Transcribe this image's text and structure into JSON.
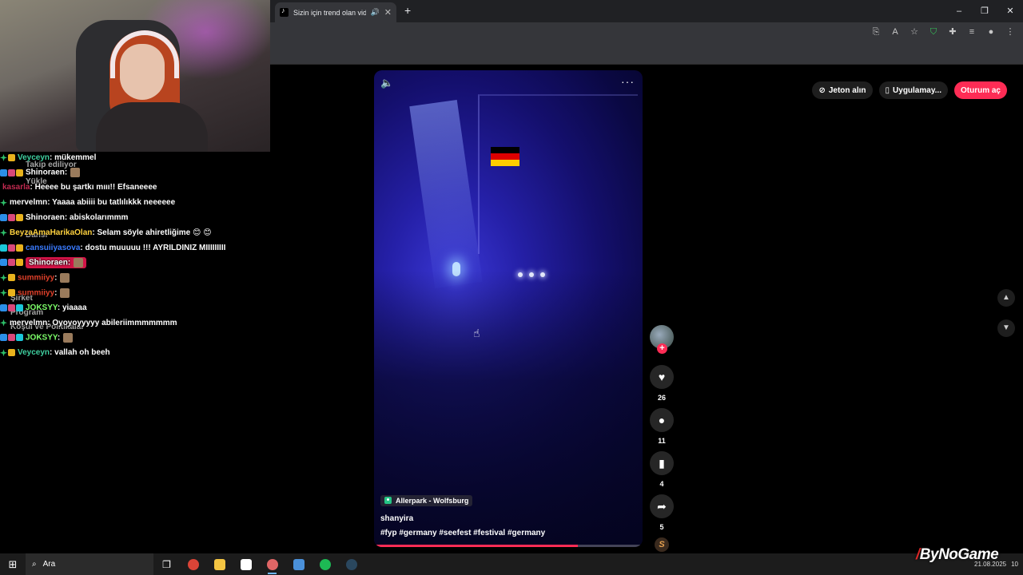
{
  "browser": {
    "tab_title": "Sizin için trend olan videolar",
    "tab_audio_icon": "speaker-icon",
    "tab_close": "✕",
    "new_tab": "+",
    "window_minimize": "–",
    "window_restore": "❐",
    "window_close": "✕"
  },
  "tiktok": {
    "coins_label": "Jeton alın",
    "app_label": "Uygulamay...",
    "login_label": "Oturum aç",
    "location": "Allerpark - Wolfsburg",
    "author": "shanyira",
    "hashtags": "#fyp #germany #seefest #festival #germany",
    "likes": "26",
    "comments": "11",
    "saves": "4",
    "shares": "5",
    "music_disc": "S",
    "progress": 0.76,
    "flag_colors": [
      "#000000",
      "#dd0000",
      "#ffce00"
    ],
    "accent": "#fe2c55"
  },
  "chat": {
    "messages": [
      {
        "user": "Veyceyn",
        "color": "#3fd0a0",
        "text": ": mükemmel",
        "badges": [
          "green",
          "gold"
        ]
      },
      {
        "user": "Shinoraen",
        "color": "#ffffff",
        "text": ":",
        "badges": [
          "blue",
          "pink",
          "gold"
        ],
        "emote": true
      },
      {
        "user": "kasarla",
        "color": "#c22a50",
        "text": ": Heeee bu şartkı mııı!! Efsaneeee",
        "badges": []
      },
      {
        "user": "mervelmn",
        "color": "#ffffff",
        "text": ": Yaaaa abiiii bu tatlılıkkk neeeeee",
        "badges": [
          "green"
        ]
      },
      {
        "user": "Shinoraen",
        "color": "#ffffff",
        "text": ": abiskolarımmm",
        "badges": [
          "blue",
          "pink",
          "gold"
        ]
      },
      {
        "user": "BeyzaAmaHarikaOlan",
        "color": "#ffd23f",
        "text": ": Selam söyle ahiretliğime 😊 😊",
        "badges": [
          "green"
        ]
      },
      {
        "user": "cansuiiyasova",
        "color": "#3a7bff",
        "text": ": dostu muuuuu !!! AYRILDINIZ MIIIIIIIII",
        "badges": [
          "cyan",
          "pink",
          "gold"
        ]
      },
      {
        "user": "Shinoraen",
        "color": "#ffffff",
        "text": ":",
        "badges": [
          "blue",
          "pink",
          "gold"
        ],
        "emote": true,
        "highlight": true
      },
      {
        "user": "summiiyy",
        "color": "#e0402a",
        "text": ":",
        "badges": [
          "green",
          "gold"
        ],
        "emote": true
      },
      {
        "user": "summiiyy",
        "color": "#e0402a",
        "text": ":",
        "badges": [
          "green",
          "gold"
        ],
        "emote": true
      },
      {
        "user": "JOKSYY",
        "color": "#7dff6a",
        "text": ": yiaaaa",
        "badges": [
          "blue",
          "pink",
          "cyan"
        ]
      },
      {
        "user": "mervelmn",
        "color": "#ffffff",
        "text": ": Oyoyoyyyyy abileriimmmmmmm",
        "badges": [
          "green"
        ]
      },
      {
        "user": "JOKSYY",
        "color": "#7dff6a",
        "text": ":",
        "badges": [
          "blue",
          "pink",
          "cyan"
        ],
        "emote": true
      },
      {
        "user": "Veyceyn",
        "color": "#3fd0a0",
        "text": ": vallah oh beeh",
        "badges": [
          "green",
          "gold"
        ]
      }
    ],
    "ghost": {
      "following": "Takip ediliyor",
      "upload": "Yükle",
      "dance": "Dansı",
      "company": "Şirket",
      "program": "Program",
      "terms": "Koşul ve Politikalar"
    }
  },
  "taskbar": {
    "search_label": "Ara",
    "date": "21.08.2025",
    "notifications": "10"
  },
  "watermark": {
    "text": "ByNoGame"
  }
}
